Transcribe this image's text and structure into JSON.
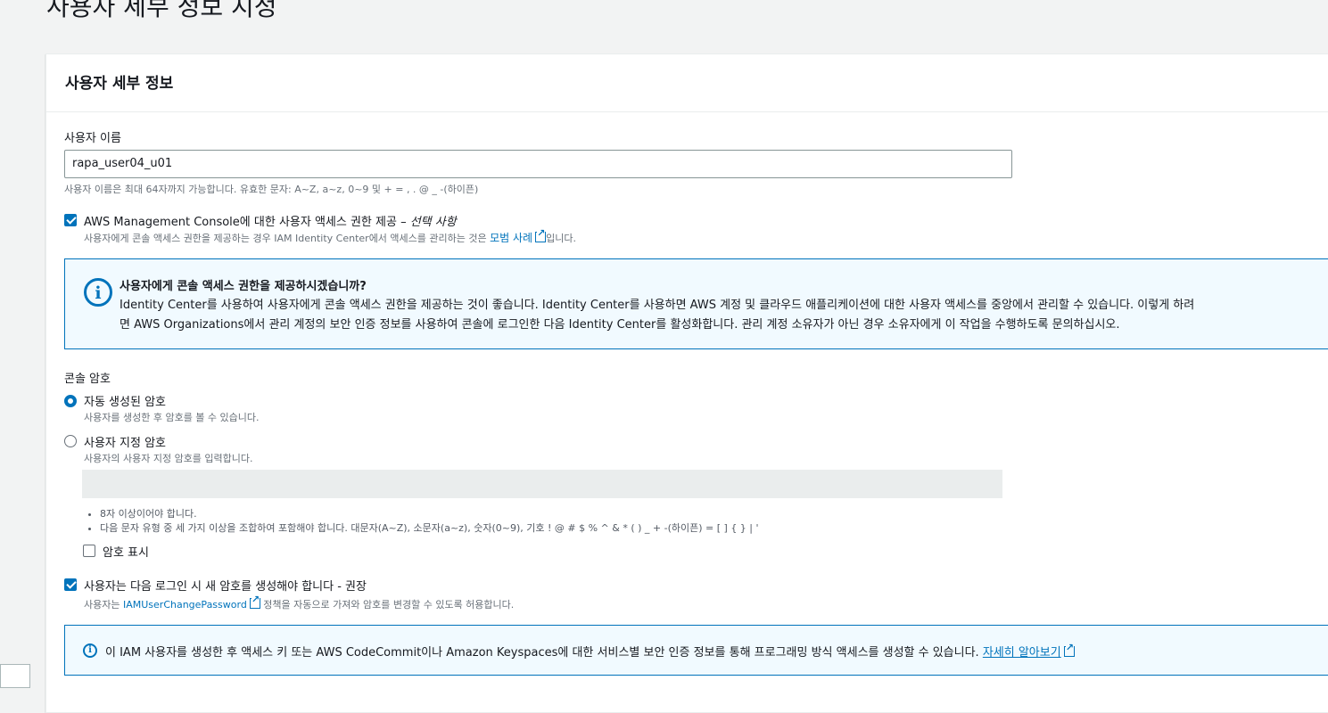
{
  "page": {
    "title": "사용자 세부 정보 지정"
  },
  "panel": {
    "title": "사용자 세부 정보",
    "username": {
      "label": "사용자 이름",
      "value": "rapa_user04_u01",
      "hint": "사용자 이름은 최대 64자까지 가능합니다. 유효한 문자: A~Z, a~z, 0~9 및 + = , . @ _ -(하이픈)"
    },
    "console_access": {
      "checked": true,
      "label": "AWS Management Console에 대한 사용자 액세스 권한 제공 – ",
      "label_optional": "선택 사항",
      "desc_prefix": "사용자에게 콘솔 액세스 권한을 제공하는 경우 IAM Identity Center에서 액세스를 관리하는 것은 ",
      "desc_link": "모범 사례",
      "desc_suffix": "입니다."
    },
    "info_box": {
      "title": "사용자에게 콘솔 액세스 권한을 제공하시겠습니까?",
      "line1": "Identity Center를 사용하여 사용자에게 콘솔 액세스 권한을 제공하는 것이 좋습니다. Identity Center를 사용하면 AWS 계정 및 클라우드 애플리케이션에 대한 사용자 액세스를 중앙에서 관리할 수 있습니다. 이렇게 하려",
      "line2": "면 AWS Organizations에서 관리 계정의 보안 인증 정보를 사용하여 콘솔에 로그인한 다음 Identity Center를 활성화합니다. 관리 계정 소유자가 아닌 경우 소유자에게 이 작업을 수행하도록 문의하십시오."
    },
    "password": {
      "label": "콘솔 암호",
      "options": [
        {
          "label": "자동 생성된 암호",
          "desc": "사용자를 생성한 후 암호를 볼 수 있습니다.",
          "selected": true
        },
        {
          "label": "사용자 지정 암호",
          "desc": "사용자의 사용자 지정 암호를 입력합니다.",
          "selected": false
        }
      ],
      "rules": [
        "8자 이상이어야 합니다.",
        "다음 문자 유형 중 세 가지 이상을 조합하여 포함해야 합니다. 대문자(A~Z), 소문자(a~z), 숫자(0~9), 기호 ! @ # $ % ^ & * ( ) _ + -(하이픈) = [ ] { } | '"
      ],
      "show_password": {
        "label": "암호 표시",
        "checked": false
      }
    },
    "reset_required": {
      "checked": true,
      "label": "사용자는 다음 로그인 시 새 암호를 생성해야 합니다 - 권장",
      "desc_prefix": "사용자는 ",
      "desc_link": "IAMUserChangePassword",
      "desc_suffix": " 정책을 자동으로 가져와 암호를 변경할 수 있도록 허용합니다."
    },
    "info_bottom": {
      "text": "이 IAM 사용자를 생성한 후 액세스 키 또는 AWS CodeCommit이나 Amazon Keyspaces에 대한 서비스별 보안 인증 정보를 통해 프로그래밍 방식 액세스를 생성할 수 있습니다. ",
      "link": "자세히 알아보기"
    }
  },
  "colors": {
    "accent": "#0073bb",
    "info_bg": "#f1faff"
  }
}
